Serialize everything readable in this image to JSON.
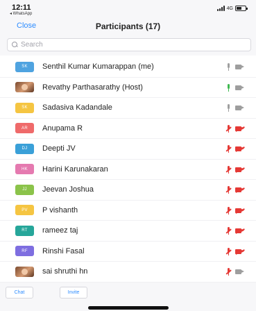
{
  "status": {
    "time": "12:11",
    "back_app": "◂ WhatsApp",
    "network": "4G",
    "battery_level": 0.6
  },
  "header": {
    "close_label": "Close",
    "title": "Participants (17)"
  },
  "search": {
    "placeholder": "Search",
    "value": ""
  },
  "participants": [
    {
      "name": "Senthil Kumar Kumarappan (me)",
      "initials": "SK",
      "avatar_color": "#4fa3e0",
      "photo": false,
      "mic": "on",
      "mic_color": "#9e9e9e",
      "video": "on",
      "video_color": "#9e9e9e"
    },
    {
      "name": "Revathy Parthasarathy (Host)",
      "initials": "",
      "avatar_color": "#8a5a3a",
      "photo": true,
      "mic": "active",
      "mic_color": "#3fb950",
      "video": "on",
      "video_color": "#9e9e9e"
    },
    {
      "name": "Sadasiva Kadandale",
      "initials": "SK",
      "avatar_color": "#f5c542",
      "photo": false,
      "mic": "on",
      "mic_color": "#9e9e9e",
      "video": "on",
      "video_color": "#9e9e9e"
    },
    {
      "name": "Anupama R",
      "initials": "AR",
      "avatar_color": "#ef6a6a",
      "photo": false,
      "mic": "muted",
      "mic_color": "#e53935",
      "video": "off",
      "video_color": "#e53935"
    },
    {
      "name": "Deepti JV",
      "initials": "DJ",
      "avatar_color": "#3aa0d8",
      "photo": false,
      "mic": "muted",
      "mic_color": "#e53935",
      "video": "off",
      "video_color": "#e53935"
    },
    {
      "name": "Harini Karunakaran",
      "initials": "HK",
      "avatar_color": "#e57ab0",
      "photo": false,
      "mic": "muted",
      "mic_color": "#e53935",
      "video": "off",
      "video_color": "#e53935"
    },
    {
      "name": "Jeevan Joshua",
      "initials": "JJ",
      "avatar_color": "#8bc34a",
      "photo": false,
      "mic": "muted",
      "mic_color": "#e53935",
      "video": "off",
      "video_color": "#e53935"
    },
    {
      "name": "P vishanth",
      "initials": "PV",
      "avatar_color": "#f5c542",
      "photo": false,
      "mic": "muted",
      "mic_color": "#e53935",
      "video": "off",
      "video_color": "#e53935"
    },
    {
      "name": "rameez taj",
      "initials": "RT",
      "avatar_color": "#26a69a",
      "photo": false,
      "mic": "muted",
      "mic_color": "#e53935",
      "video": "off",
      "video_color": "#e53935"
    },
    {
      "name": "Rinshi Fasal",
      "initials": "RF",
      "avatar_color": "#7e6ee0",
      "photo": false,
      "mic": "muted",
      "mic_color": "#e53935",
      "video": "off",
      "video_color": "#e53935"
    },
    {
      "name": "sai shruthi hn",
      "initials": "",
      "avatar_color": "#6b4a2e",
      "photo": true,
      "mic": "muted",
      "mic_color": "#e53935",
      "video": "on",
      "video_color": "#9e9e9e"
    }
  ],
  "footer": {
    "chat_label": "Chat",
    "invite_label": "Invite"
  }
}
